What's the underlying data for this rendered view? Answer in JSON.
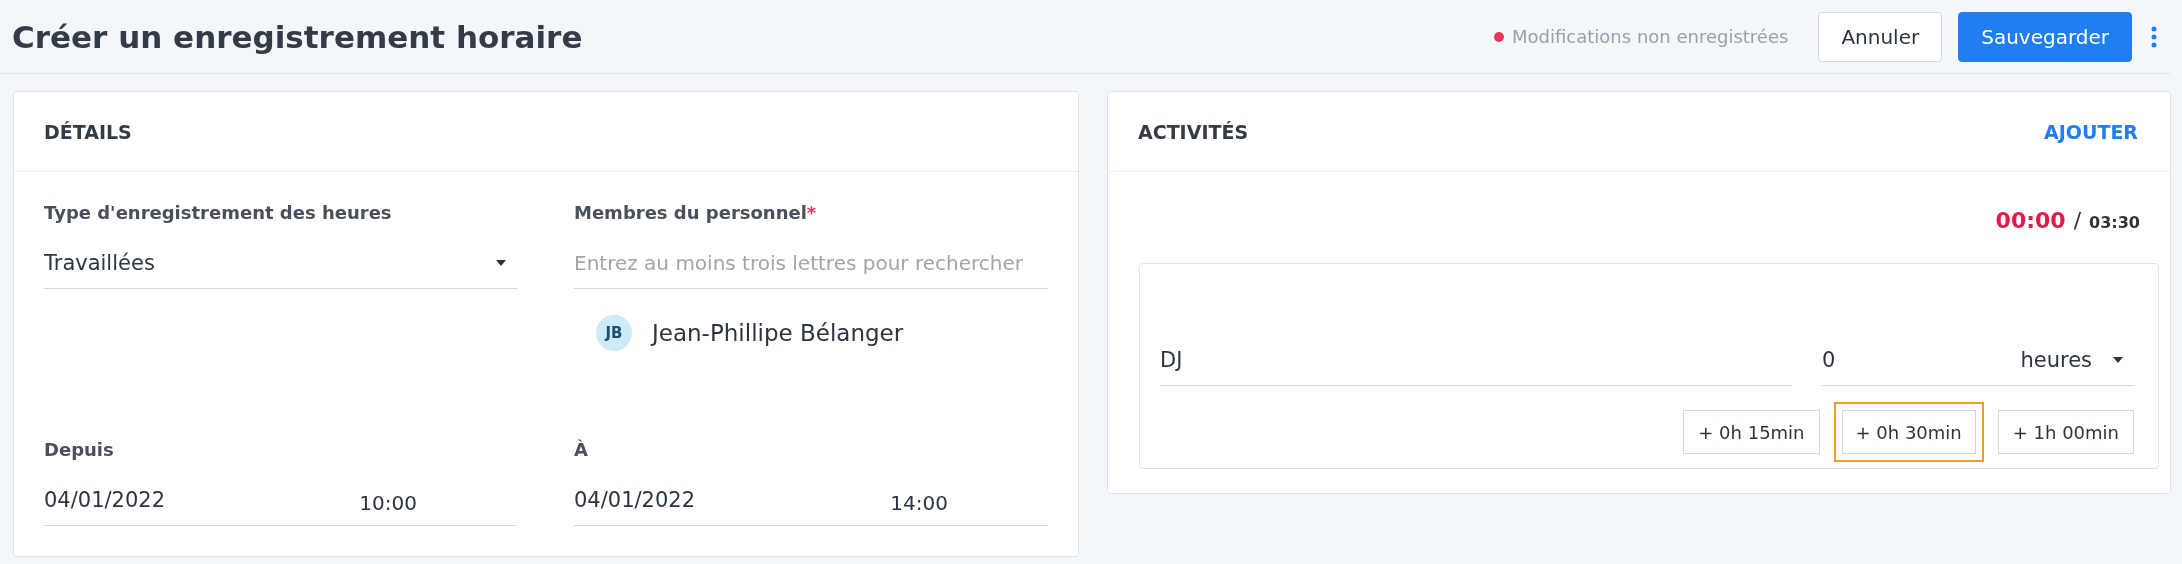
{
  "page": {
    "title": "Créer un enregistrement horaire"
  },
  "header": {
    "unsaved_notice": "Modifications non enregistrées",
    "unsaved": true,
    "cancel_button": "Annuler",
    "save_button": "Sauvegarder"
  },
  "details": {
    "title": "DÉTAILS",
    "type_field": {
      "label": "Type d'enregistrement des heures",
      "value": "Travaillées"
    },
    "staff_field": {
      "label": "Membres du personnel",
      "required_mark": "*",
      "placeholder": "Entrez au moins trois lettres pour rechercher"
    },
    "staff_members": [
      {
        "initials": "JB",
        "name": "Jean-Phillipe Bélanger"
      }
    ],
    "from_field": {
      "label": "Depuis",
      "date": "04/01/2022",
      "time": "10:00"
    },
    "to_field": {
      "label": "À",
      "date": "04/01/2022",
      "time": "14:00"
    }
  },
  "activities": {
    "title": "ACTIVITÉS",
    "add_link": "AJOUTER",
    "total_logged": "00:00",
    "separator": "/",
    "total_expected": "03:30",
    "items": [
      {
        "name": "DJ",
        "amount": "0",
        "unit": "heures",
        "quick_buttons": [
          {
            "label": "+ 0h 15min",
            "focused": false
          },
          {
            "label": "+ 0h 30min",
            "focused": true
          },
          {
            "label": "+ 1h 00min",
            "focused": false
          }
        ]
      }
    ]
  }
}
